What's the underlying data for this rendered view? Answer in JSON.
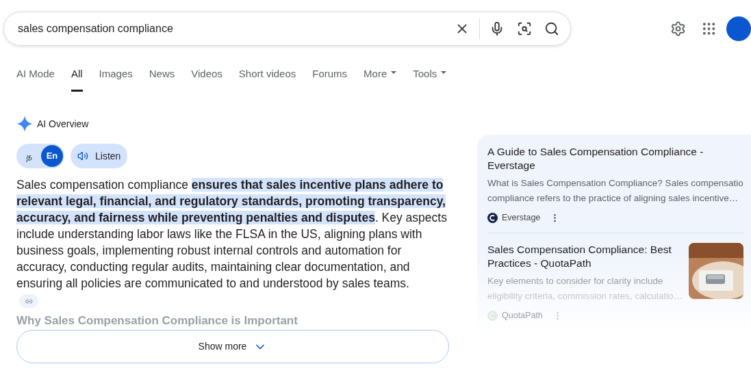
{
  "search": {
    "value": "sales compensation compliance"
  },
  "tabs": [
    {
      "label": "AI Mode",
      "selected": false,
      "dropdown": false
    },
    {
      "label": "All",
      "selected": true,
      "dropdown": false
    },
    {
      "label": "Images",
      "selected": false,
      "dropdown": false
    },
    {
      "label": "News",
      "selected": false,
      "dropdown": false
    },
    {
      "label": "Videos",
      "selected": false,
      "dropdown": false
    },
    {
      "label": "Short videos",
      "selected": false,
      "dropdown": false
    },
    {
      "label": "Forums",
      "selected": false,
      "dropdown": false
    },
    {
      "label": "More",
      "selected": false,
      "dropdown": true
    },
    {
      "label": "Tools",
      "selected": false,
      "dropdown": true
    }
  ],
  "ai_overview": {
    "title": "AI Overview",
    "languages": [
      {
        "label": "த",
        "selected": false
      },
      {
        "label": "En",
        "selected": true
      }
    ],
    "listen": "Listen",
    "summary": "Sales compensation compliance **ensures that sales incentive plans adhere to relevant legal, financial, and regulatory standards, promoting transparency, accuracy, and fairness while preventing penalties and disputes**. Key aspects include understanding labor laws like the FLSA in the US, aligning plans with business goals, implementing robust internal controls and automation for accuracy, conducting regular audits, maintaining clear documentation, and ensuring all policies are communicated to and understood by sales teams.",
    "faded_heading": "Why Sales Compensation Compliance is Important",
    "show_more": "Show more"
  },
  "sources": [
    {
      "title": "A Guide to Sales Compensation Compliance - Everstage",
      "snippet": [
        "What is Sales Compensation Compliance? Sales compensatio",
        "compliance refers to the practice of aligning sales incentive…"
      ],
      "site": "Everstage",
      "faded": false,
      "thumbnail": false
    },
    {
      "title": "Sales Compensation Compliance: Best Practices - QuotaPath",
      "snippet": [
        "Key elements to consider for clarity include",
        "eligibility criteria, commission rates, calculatio…"
      ],
      "site": "QuotaPath",
      "faded": true,
      "thumbnail": true
    }
  ]
}
